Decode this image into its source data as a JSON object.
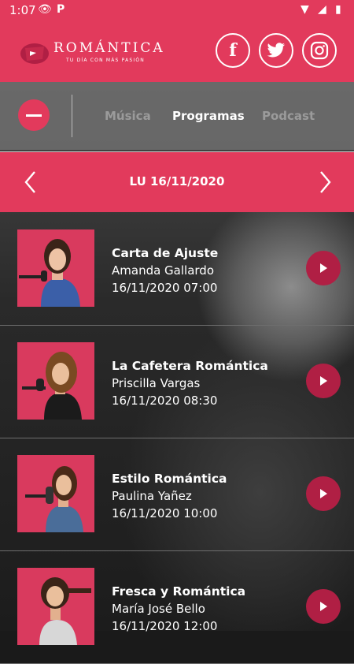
{
  "status_bar": {
    "time": "1:07"
  },
  "header": {
    "logo_name": "ROMÁNTICA",
    "logo_tagline": "TU DÍA CON MÁS PASIÓN",
    "social": [
      {
        "icon": "facebook-icon",
        "glyph": "f"
      },
      {
        "icon": "twitter-icon",
        "glyph": "🐦"
      },
      {
        "icon": "instagram-icon",
        "glyph": ""
      }
    ]
  },
  "tabs": [
    {
      "label": "Música",
      "active": false
    },
    {
      "label": "Programas",
      "active": true
    },
    {
      "label": "Podcast",
      "active": false
    }
  ],
  "date_nav": {
    "label": "LU 16/11/2020"
  },
  "programs": [
    {
      "title": "Carta de Ajuste",
      "host": "Amanda Gallardo",
      "datetime": "16/11/2020 07:00"
    },
    {
      "title": "La Cafetera Romántica",
      "host": "Priscilla Vargas",
      "datetime": "16/11/2020 08:30"
    },
    {
      "title": "Estilo Romántica",
      "host": "Paulina Yañez",
      "datetime": "16/11/2020 10:00"
    },
    {
      "title": "Fresca y Romántica",
      "host": "María José Bello",
      "datetime": "16/11/2020 12:00"
    }
  ],
  "colors": {
    "brand": "#e23a5c",
    "play": "#b01f44"
  }
}
